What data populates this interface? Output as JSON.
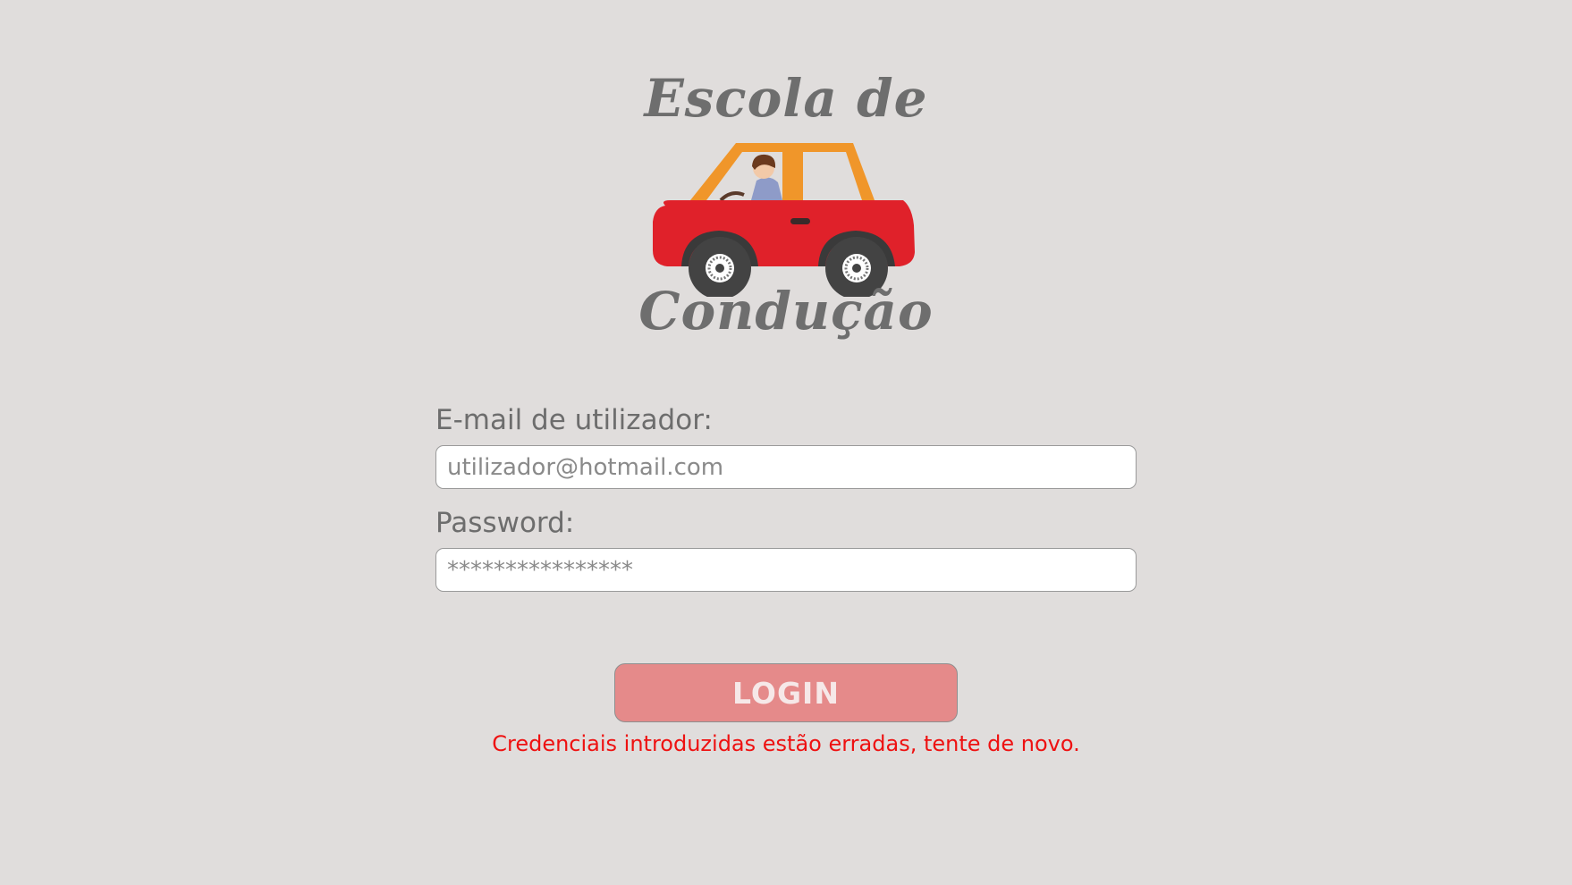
{
  "logo": {
    "line1": "Escola de",
    "line2": "Condução",
    "icon": "car-with-driver-icon"
  },
  "form": {
    "email_label": "E-mail de utilizador:",
    "email_placeholder": "utilizador@hotmail.com",
    "password_label": "Password:",
    "password_placeholder": "****************",
    "login_label": "LOGIN",
    "error_message": "Credenciais introduzidas estão erradas, tente de novo."
  },
  "colors": {
    "background": "#e0dddc",
    "button": "#e58a8a",
    "error": "#ee1111",
    "car_body": "#e0212a",
    "car_roof": "#f0962a"
  }
}
